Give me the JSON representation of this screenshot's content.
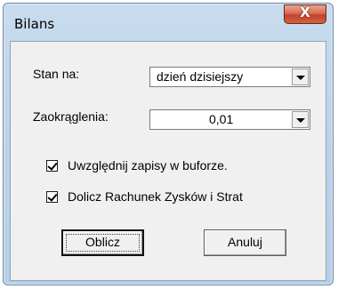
{
  "window": {
    "title": "Bilans",
    "close_glyph": "X"
  },
  "form": {
    "stan_label": "Stan na:",
    "stan_value": "dzień dzisiejszy",
    "zaokraglenia_label": "Zaokrąglenia:",
    "zaokraglenia_value": "0,01",
    "checkbox_bufor": {
      "label": "Uwzględnij zapisy w buforze.",
      "checked": true
    },
    "checkbox_rzis": {
      "label": "Dolicz Rachunek Zysków i Strat",
      "checked": true
    }
  },
  "buttons": {
    "oblicz": "Oblicz",
    "anuluj": "Anuluj"
  }
}
